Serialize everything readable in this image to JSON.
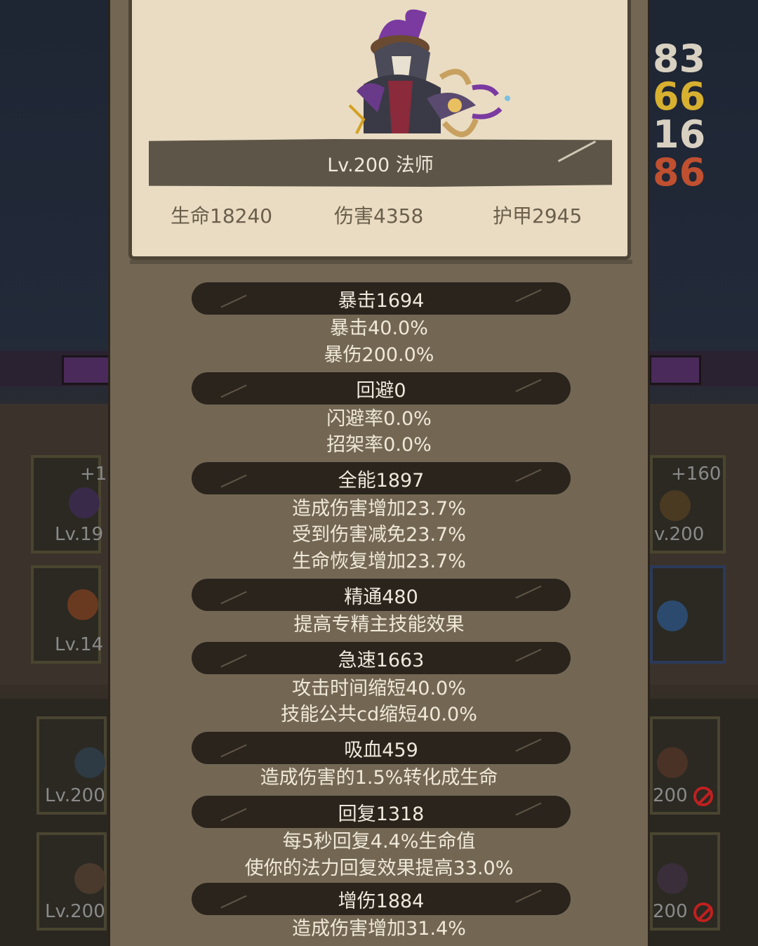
{
  "hero": {
    "title": "Lv.200 法师",
    "stats": [
      {
        "label": "生命18240"
      },
      {
        "label": "伤害4358"
      },
      {
        "label": "护甲2945"
      }
    ]
  },
  "background": {
    "right_numbers": [
      "83",
      "66",
      "16",
      "86"
    ],
    "left_slots": [
      {
        "plus": "+1",
        "level": "Lv.19"
      },
      {
        "plus": "",
        "level": "Lv.14"
      }
    ],
    "right_slots": [
      {
        "plus": "+160",
        "level": "v.200"
      },
      {
        "plus": "",
        "level": ""
      }
    ],
    "left_lower_slots": [
      {
        "level": "Lv.200"
      },
      {
        "level": "Lv.200"
      }
    ],
    "right_lower_slots": [
      {
        "level": "200"
      },
      {
        "level": "200"
      }
    ]
  },
  "groups": [
    {
      "header": "暴击1694",
      "lines": [
        "暴击40.0%",
        "暴伤200.0%"
      ]
    },
    {
      "header": "回避0",
      "lines": [
        "闪避率0.0%",
        "招架率0.0%"
      ]
    },
    {
      "header": "全能1897",
      "lines": [
        "造成伤害增加23.7%",
        "受到伤害减免23.7%",
        "生命恢复增加23.7%"
      ]
    },
    {
      "header": "精通480",
      "lines": [
        "提高专精主技能效果"
      ]
    },
    {
      "header": "急速1663",
      "lines": [
        "攻击时间缩短40.0%",
        "技能公共cd缩短40.0%"
      ]
    },
    {
      "header": "吸血459",
      "lines": [
        "造成伤害的1.5%转化成生命"
      ]
    },
    {
      "header": "回复1318",
      "lines": [
        "每5秒回复4.4%生命值",
        "使你的法力回复效果提高33.0%"
      ]
    },
    {
      "header": "增伤1884",
      "lines": [
        "造成伤害增加31.4%"
      ]
    }
  ],
  "colors": {
    "panel": "#736754",
    "card": "#e9dcc2",
    "pill": "#2a241d",
    "text_light": "#f0e8d8",
    "text_card": "#6a5e4c"
  }
}
